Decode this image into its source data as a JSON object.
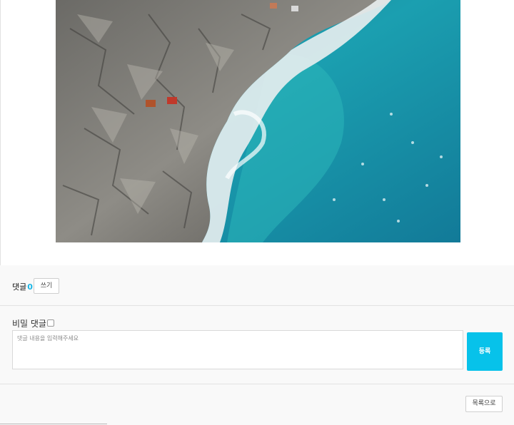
{
  "photo": {
    "description_icon": "coastal-rocks-photo"
  },
  "comments": {
    "label": "댓글",
    "count": "0",
    "write_button": "쓰기"
  },
  "form": {
    "secret_label": "비밀 댓글",
    "textarea_placeholder": "댓글 내용을 입력해주세요",
    "submit_button": "등록"
  },
  "list": {
    "button": "목록으로"
  },
  "colors": {
    "accent": "#07c2ea",
    "count": "#19b6e6",
    "panel_bg": "#f9f9f9"
  }
}
